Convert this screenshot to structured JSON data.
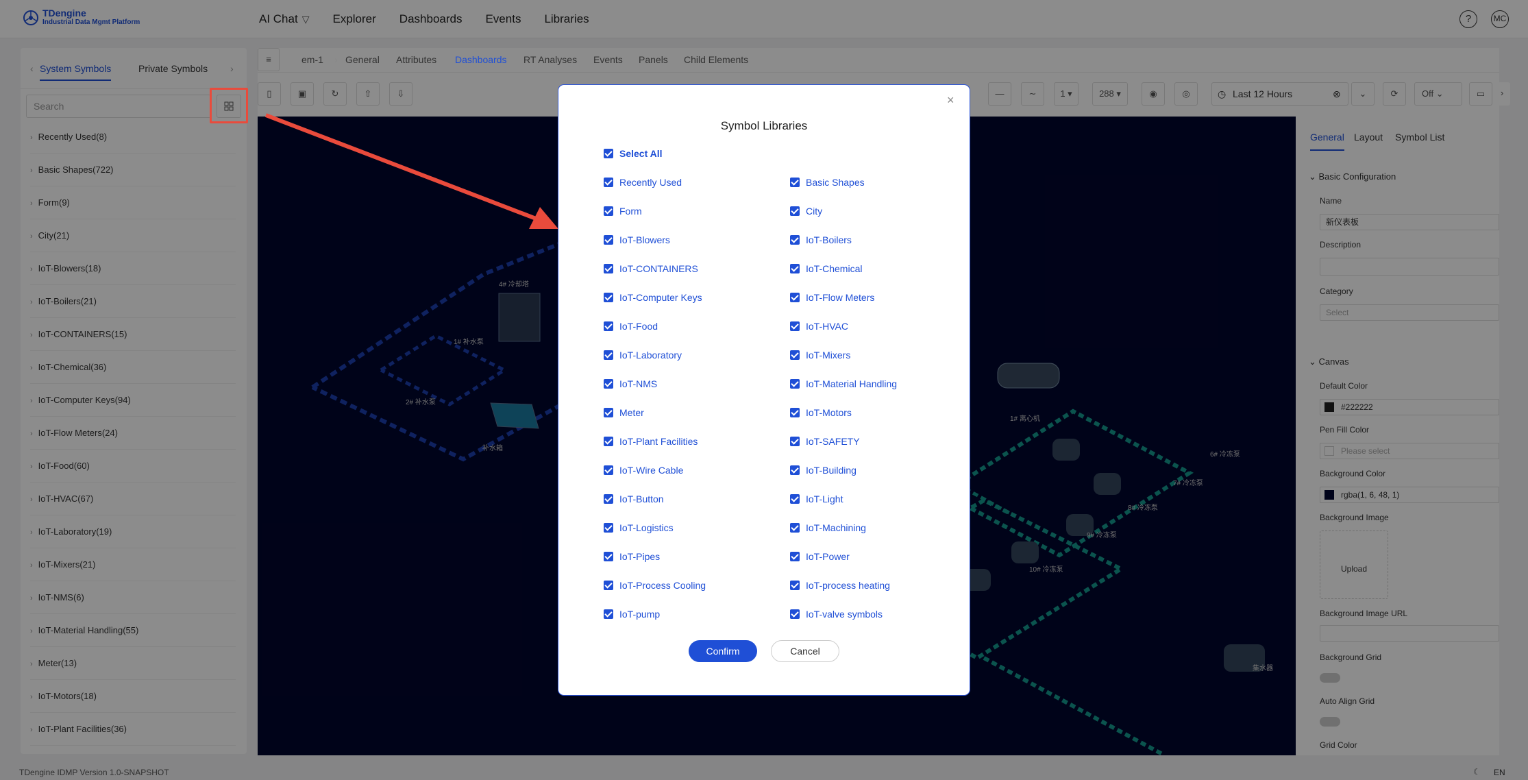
{
  "app": {
    "brand": "TDengine",
    "subtitle": "Industrial Data Mgmt Platform",
    "nav": [
      "AI Chat",
      "Explorer",
      "Dashboards",
      "Events",
      "Libraries"
    ],
    "help": "?",
    "avatar": "MC"
  },
  "left_panel": {
    "tabs": [
      "System Symbols",
      "Private Symbols"
    ],
    "search_placeholder": "Search",
    "libraries": [
      "Recently Used(8)",
      "Basic Shapes(722)",
      "Form(9)",
      "City(21)",
      "IoT-Blowers(18)",
      "IoT-Boilers(21)",
      "IoT-CONTAINERS(15)",
      "IoT-Chemical(36)",
      "IoT-Computer Keys(94)",
      "IoT-Flow Meters(24)",
      "IoT-Food(60)",
      "IoT-HVAC(67)",
      "IoT-Laboratory(19)",
      "IoT-Mixers(21)",
      "IoT-NMS(6)",
      "IoT-Material Handling(55)",
      "Meter(13)",
      "IoT-Motors(18)",
      "IoT-Plant Facilities(36)"
    ]
  },
  "breadcrumb": [
    "em-1",
    "General",
    "Attributes",
    "Dashboards",
    "RT Analyses",
    "Events",
    "Panels",
    "Child Elements"
  ],
  "toolbar": {
    "interval": "1",
    "points": "288",
    "time_range": "Last 12 Hours",
    "refresh": "Off"
  },
  "props": {
    "tabs": [
      "General",
      "Layout",
      "Symbol List"
    ],
    "basic_section": "Basic Configuration",
    "name_label": "Name",
    "name_value": "新仪表板",
    "description_label": "Description",
    "category_label": "Category",
    "category_placeholder": "Select",
    "canvas_section": "Canvas",
    "default_color_label": "Default Color",
    "default_color_value": "#222222",
    "pen_fill_label": "Pen Fill Color",
    "pen_fill_placeholder": "Please select",
    "bg_color_label": "Background Color",
    "bg_color_value": "rgba(1, 6, 48, 1)",
    "bg_image_label": "Background Image",
    "upload": "Upload",
    "bg_image_url_label": "Background Image URL",
    "bg_grid_label": "Background Grid",
    "auto_align_label": "Auto Align Grid",
    "grid_color_label": "Grid Color"
  },
  "footer": {
    "version": "TDengine IDMP Version 1.0-SNAPSHOT",
    "lang": "EN"
  },
  "canvas_labels": [
    "4# 冷却塔",
    "1# 补水泵",
    "2# 补水泵",
    "补水箱",
    "1# 离心机",
    "6# 冷冻泵",
    "7# 冷冻泵",
    "8# 冷冻泵",
    "9# 冷冻泵",
    "10# 冷冻泵",
    "集水器"
  ],
  "modal": {
    "title": "Symbol Libraries",
    "close": "×",
    "select_all": "Select All",
    "left_column": [
      "Recently Used",
      "Form",
      "IoT-Blowers",
      "IoT-CONTAINERS",
      "IoT-Computer Keys",
      "IoT-Food",
      "IoT-Laboratory",
      "IoT-NMS",
      "Meter",
      "IoT-Plant Facilities",
      "IoT-Wire Cable",
      "IoT-Button",
      "IoT-Logistics",
      "IoT-Pipes",
      "IoT-Process Cooling",
      "IoT-pump"
    ],
    "right_column": [
      "Basic Shapes",
      "City",
      "IoT-Boilers",
      "IoT-Chemical",
      "IoT-Flow Meters",
      "IoT-HVAC",
      "IoT-Mixers",
      "IoT-Material Handling",
      "IoT-Motors",
      "IoT-SAFETY",
      "IoT-Building",
      "IoT-Light",
      "IoT-Machining",
      "IoT-Power",
      "IoT-process heating",
      "IoT-valve symbols"
    ],
    "confirm": "Confirm",
    "cancel": "Cancel"
  },
  "colors": {
    "accent": "#1f4fd6",
    "canvas_bg": "#01062e",
    "highlight": "#e94b3c"
  }
}
